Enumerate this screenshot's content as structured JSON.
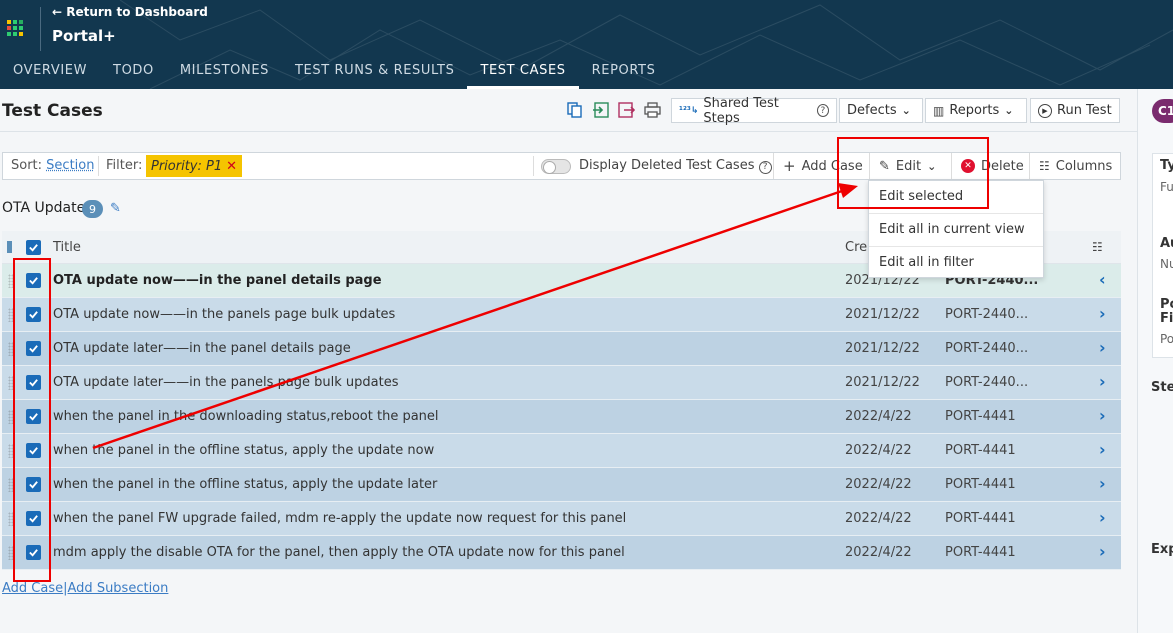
{
  "header": {
    "return_label": "← Return to Dashboard",
    "app_name": "Portal+",
    "nav": [
      {
        "label": "OVERVIEW"
      },
      {
        "label": "TODO"
      },
      {
        "label": "MILESTONES"
      },
      {
        "label": "TEST RUNS & RESULTS"
      },
      {
        "label": "TEST CASES",
        "active": true
      },
      {
        "label": "REPORTS"
      }
    ]
  },
  "page": {
    "title": "Test Cases",
    "toolbar": {
      "shared_steps": "Shared Test Steps",
      "defects": "Defects",
      "reports": "Reports",
      "run_test": "Run Test"
    }
  },
  "filterbar": {
    "sort_label": "Sort:",
    "sort_value": "Section",
    "filter_label": "Filter:",
    "filter_chip": "Priority: P1",
    "display_deleted": "Display Deleted Test Cases",
    "add_case": "Add Case",
    "edit": "Edit",
    "delete": "Delete",
    "columns": "Columns"
  },
  "edit_menu": {
    "items": [
      "Edit selected",
      "Edit all in current view",
      "Edit all in filter"
    ]
  },
  "section": {
    "name": "OTA Update",
    "count": "9"
  },
  "table": {
    "headers": {
      "title": "Title",
      "created": "Cre"
    },
    "rows": [
      {
        "title": "OTA update now——in the panel details page",
        "date": "2021/12/22",
        "ref": "PORT-2440..."
      },
      {
        "title": "OTA update now——in the panels page bulk updates",
        "date": "2021/12/22",
        "ref": "PORT-2440..."
      },
      {
        "title": "OTA update later——in the panel details page",
        "date": "2021/12/22",
        "ref": "PORT-2440..."
      },
      {
        "title": "OTA update later——in the panels page bulk updates",
        "date": "2021/12/22",
        "ref": "PORT-2440..."
      },
      {
        "title": "when the panel in the downloading status,reboot the panel",
        "date": "2022/4/22",
        "ref": "PORT-4441"
      },
      {
        "title": "when the panel in the offline status, apply the update now",
        "date": "2022/4/22",
        "ref": "PORT-4441"
      },
      {
        "title": "when the panel in the offline status, apply the update later",
        "date": "2022/4/22",
        "ref": "PORT-4441"
      },
      {
        "title": "when the panel FW upgrade failed, mdm re-apply the update now request for this panel",
        "date": "2022/4/22",
        "ref": "PORT-4441"
      },
      {
        "title": "mdm apply the disable OTA for the panel, then apply the OTA update now for this panel",
        "date": "2022/4/22",
        "ref": "PORT-4441"
      }
    ]
  },
  "footer": {
    "add_case": "Add Case",
    "separator": "|",
    "add_subsection": "Add Subsection"
  },
  "right_panel": {
    "case_id": "C1",
    "labels": [
      "Ty",
      "Fu",
      "Au",
      "Nu",
      "Po",
      "Fi",
      "Po",
      "Ste",
      "Exp"
    ]
  },
  "colors": {
    "header_bg": "#12374f",
    "accent": "#1a6bb8",
    "filter_chip": "#f5c400",
    "annotation": "#ee0000"
  }
}
